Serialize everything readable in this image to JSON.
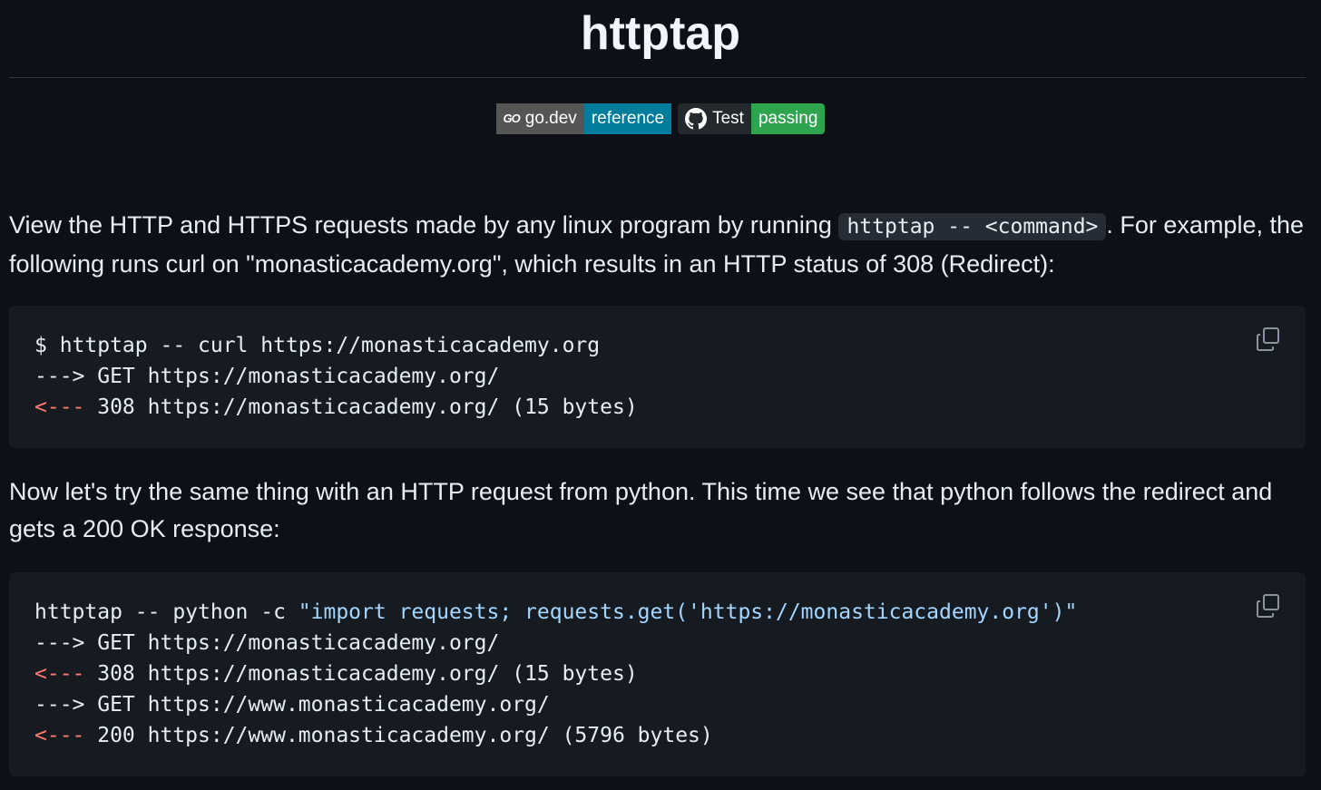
{
  "page": {
    "title": "httptap"
  },
  "badges": {
    "go": {
      "logo": "GO",
      "left": "go.dev",
      "right": "reference"
    },
    "test": {
      "icon": "github-icon",
      "left": "Test",
      "right": "passing"
    }
  },
  "intro": {
    "text_before": "View the HTTP and HTTPS requests made by any linux program by running ",
    "inline_code": "httptap -- <command>",
    "text_after": ". For example, the following runs curl on \"monasticacademy.org\", which results in an HTTP status of 308 (Redirect):"
  },
  "code1": {
    "lines": [
      {
        "prefix": "",
        "text": "$ httptap -- curl https://monasticacademy.org"
      },
      {
        "prefix": "--->",
        "text": " GET https://monasticacademy.org/"
      },
      {
        "prefix": "<---",
        "text": " 308 https://monasticacademy.org/ (15 bytes)"
      }
    ]
  },
  "second": {
    "text": "Now let's try the same thing with an HTTP request from python. This time we see that python follows the redirect and gets a 200 OK response:"
  },
  "code2": {
    "cmd": "httptap -- python -c ",
    "cmd_string": "\"import requests; requests.get('https://monasticacademy.org')\"",
    "lines": [
      {
        "prefix": "--->",
        "text": " GET https://monasticacademy.org/"
      },
      {
        "prefix": "<---",
        "text": " 308 https://monasticacademy.org/ (15 bytes)"
      },
      {
        "prefix": "--->",
        "text": " GET https://www.monasticacademy.org/"
      },
      {
        "prefix": "<---",
        "text": " 200 https://www.monasticacademy.org/ (5796 bytes)"
      }
    ]
  },
  "icons": {
    "copy": "copy-icon"
  },
  "colors": {
    "background": "#0d1117",
    "code_background": "#161b22",
    "badge_go_right": "#007d9c",
    "badge_test_right": "#2ea44f",
    "arrow_in": "#ff7b72",
    "string": "#a5d6ff"
  }
}
